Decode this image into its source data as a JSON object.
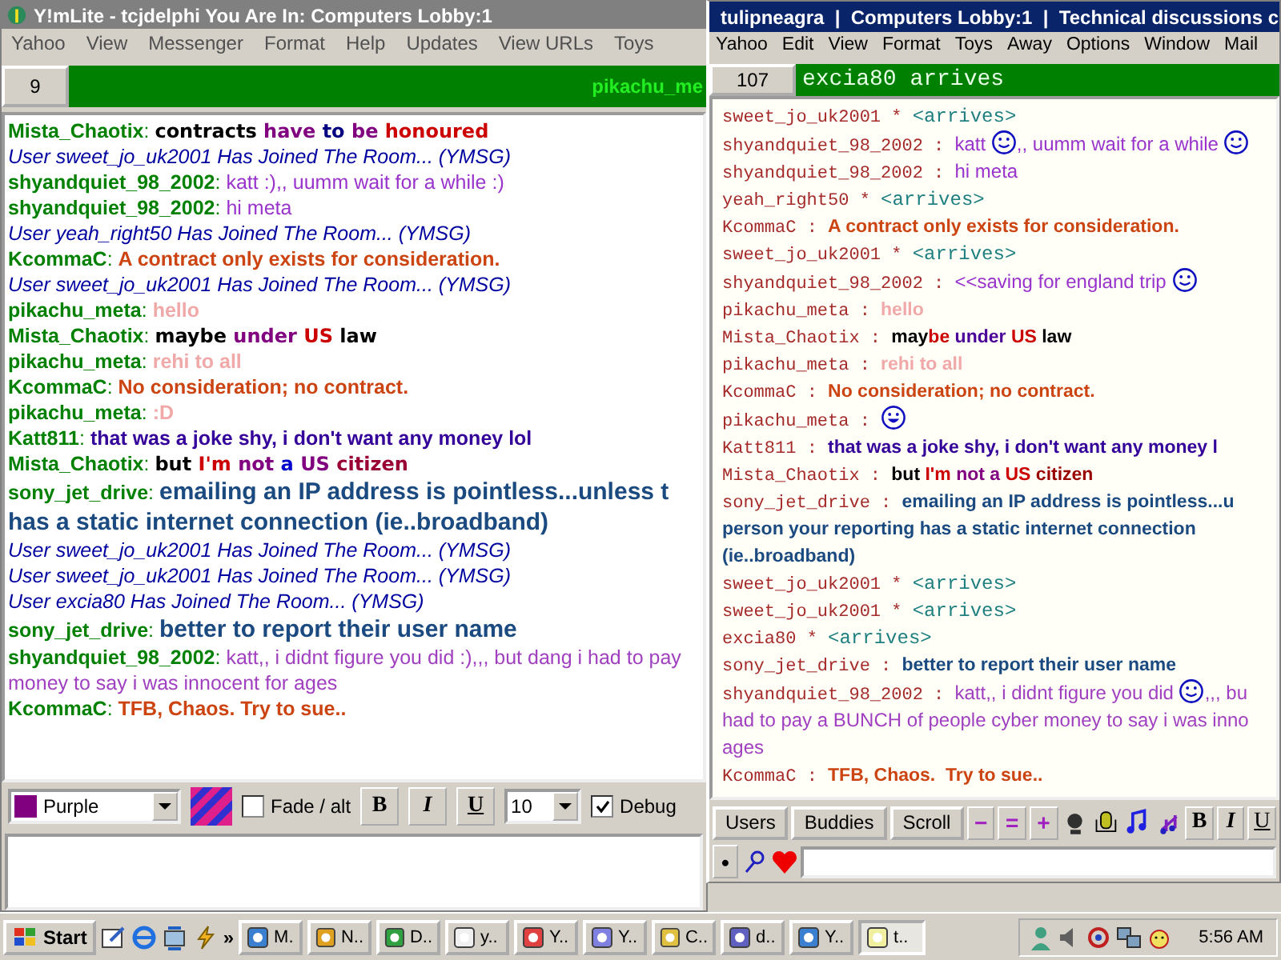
{
  "left_window": {
    "title": "Y!mLite - tcjdelphi You Are In: Computers Lobby:1",
    "menu": [
      "Yahoo",
      "View",
      "Messenger",
      "Format",
      "Help",
      "Updates",
      "View URLs",
      "Toys"
    ],
    "counter": "9",
    "ticker": "pikachu_me",
    "messages": [
      {
        "name": "Mista_Chaotix",
        "separator": ":",
        "kind": "comic",
        "segments": [
          {
            "kind": "text",
            "text": "contracts ",
            "color": "#000000"
          },
          {
            "kind": "text",
            "text": "have ",
            "color": "#800080"
          },
          {
            "kind": "text",
            "text": "to ",
            "color": "#000080"
          },
          {
            "kind": "text",
            "text": "be ",
            "color": "#800080"
          },
          {
            "kind": "text",
            "text": "honoured",
            "color": "#cc0000"
          }
        ]
      },
      {
        "kind": "join",
        "segments": [
          {
            "kind": "text",
            "text": "User sweet_jo_uk2001 Has Joined The Room... (YMSG)",
            "color": "#0000a0"
          }
        ]
      },
      {
        "name": "shyandquiet_98_2002",
        "separator": ":",
        "kind": "plain",
        "segments": [
          {
            "kind": "text",
            "text": "katt :),, uumm wait for a while :)",
            "color": "#9933cc"
          }
        ]
      },
      {
        "name": "shyandquiet_98_2002",
        "separator": ":",
        "kind": "plain",
        "segments": [
          {
            "kind": "text",
            "text": "hi meta",
            "color": "#9933cc"
          }
        ]
      },
      {
        "kind": "join",
        "segments": [
          {
            "kind": "text",
            "text": "User yeah_right50 Has Joined The Room... (YMSG)",
            "color": "#0000a0"
          }
        ]
      },
      {
        "name": "KcommaC",
        "separator": ":",
        "kind": "bold",
        "segments": [
          {
            "kind": "text",
            "text": "A contract only exists for consideration.",
            "color": "#cc4411"
          }
        ]
      },
      {
        "kind": "join",
        "segments": [
          {
            "kind": "text",
            "text": "User sweet_jo_uk2001 Has Joined The Room... (YMSG)",
            "color": "#0000a0"
          }
        ]
      },
      {
        "name": "pikachu_meta",
        "separator": ":",
        "kind": "bold",
        "segments": [
          {
            "kind": "text",
            "text": "hello",
            "color": "#f0a8a8"
          }
        ]
      },
      {
        "name": "Mista_Chaotix",
        "separator": ":",
        "kind": "comic",
        "segments": [
          {
            "kind": "text",
            "text": "maybe ",
            "color": "#000000"
          },
          {
            "kind": "text",
            "text": "under ",
            "color": "#800080"
          },
          {
            "kind": "text",
            "text": "US ",
            "color": "#cc0000"
          },
          {
            "kind": "text",
            "text": "law",
            "color": "#000000"
          }
        ]
      },
      {
        "name": "pikachu_meta",
        "separator": ":",
        "kind": "bold",
        "segments": [
          {
            "kind": "text",
            "text": "rehi to all",
            "color": "#f0a8a8"
          }
        ]
      },
      {
        "name": "KcommaC",
        "separator": ":",
        "kind": "bold",
        "segments": [
          {
            "kind": "text",
            "text": "No consideration; no contract.",
            "color": "#cc4411"
          }
        ]
      },
      {
        "name": "pikachu_meta",
        "separator": ":",
        "kind": "bold",
        "segments": [
          {
            "kind": "text",
            "text": ":D",
            "color": "#f0a8a8"
          }
        ]
      },
      {
        "name": "Katt811",
        "separator": ":",
        "kind": "bold",
        "segments": [
          {
            "kind": "text",
            "text": "that was a joke shy, i don't want any money lol",
            "color": "#330099"
          }
        ]
      },
      {
        "name": "Mista_Chaotix",
        "separator": ":",
        "kind": "comic",
        "segments": [
          {
            "kind": "text",
            "text": "but ",
            "color": "#000000"
          },
          {
            "kind": "text",
            "text": "I'm ",
            "color": "#cc0000"
          },
          {
            "kind": "text",
            "text": "not ",
            "color": "#800080"
          },
          {
            "kind": "text",
            "text": "a ",
            "color": "#0000cc"
          },
          {
            "kind": "text",
            "text": "US ",
            "color": "#800080"
          },
          {
            "kind": "text",
            "text": "citizen",
            "color": "#990033"
          }
        ]
      },
      {
        "name": "sony_jet_drive",
        "separator": ":",
        "kind": "large",
        "segments": [
          {
            "kind": "text",
            "text": "emailing an IP address is pointless...unless t",
            "color": "#1a4a80"
          }
        ],
        "continuation": [
          {
            "text": "has a static internet connection (ie..broadband)",
            "color": "#1a4a80"
          }
        ]
      },
      {
        "kind": "join",
        "segments": [
          {
            "kind": "text",
            "text": "User sweet_jo_uk2001 Has Joined The Room... (YMSG)",
            "color": "#0000a0"
          }
        ]
      },
      {
        "kind": "join",
        "segments": [
          {
            "kind": "text",
            "text": "User sweet_jo_uk2001 Has Joined The Room... (YMSG)",
            "color": "#0000a0"
          }
        ]
      },
      {
        "kind": "join",
        "segments": [
          {
            "kind": "text",
            "text": "User excia80 Has Joined The Room... (YMSG)",
            "color": "#0000a0"
          }
        ]
      },
      {
        "name": "sony_jet_drive",
        "separator": ":",
        "kind": "large",
        "segments": [
          {
            "kind": "text",
            "text": "better to report their user name",
            "color": "#1a4a80"
          }
        ]
      },
      {
        "name": "shyandquiet_98_2002",
        "separator": ":",
        "kind": "plain",
        "segments": [
          {
            "kind": "text",
            "text": "katt,, i didnt figure you did :),,, but dang i had to pay",
            "color": "#a040c0"
          }
        ],
        "continuation": [
          {
            "text": "money to say i was innocent for ages",
            "color": "#a040c0"
          }
        ]
      },
      {
        "name": "KcommaC",
        "separator": ":",
        "kind": "bold",
        "segments": [
          {
            "kind": "text",
            "text": "TFB, Chaos. Try to sue..",
            "color": "#cc4411"
          }
        ]
      }
    ],
    "toolbar": {
      "color_select": {
        "value": "Purple",
        "color": "#800080"
      },
      "fade": {
        "label": "Fade / alt",
        "checked": false
      },
      "bold": "B",
      "italic": "I",
      "underline": "U",
      "size": "10",
      "debug": {
        "label": "Debug",
        "checked": true
      }
    }
  },
  "right_window": {
    "title": "tulipneagra  |  Computers Lobby:1  |  Technical discussions c",
    "menu": [
      "Yahoo",
      "Edit",
      "View",
      "Format",
      "Toys",
      "Away",
      "Options",
      "Window",
      "Mail"
    ],
    "counter": "107",
    "ticker": "excia80 arrives",
    "messages": [
      {
        "name": "sweet_jo_uk2001",
        "separator": "*",
        "kind": "arrives",
        "segments": [
          {
            "kind": "text",
            "text": "<arrives>",
            "color": "#208080"
          }
        ]
      },
      {
        "name": "shyandquiet_98_2002",
        "separator": ":",
        "kind": "plain",
        "segments": [
          {
            "kind": "text",
            "text": "katt ",
            "color": "#9933cc"
          },
          {
            "kind": "smiley"
          },
          {
            "kind": "text",
            "text": ",, uumm wait for a while ",
            "color": "#9933cc"
          },
          {
            "kind": "smiley"
          }
        ]
      },
      {
        "name": "shyandquiet_98_2002",
        "separator": ":",
        "kind": "plain",
        "segments": [
          {
            "kind": "text",
            "text": "hi meta",
            "color": "#9933cc"
          }
        ]
      },
      {
        "name": "yeah_right50",
        "separator": "*",
        "kind": "arrives",
        "segments": [
          {
            "kind": "text",
            "text": "<arrives>",
            "color": "#208080"
          }
        ]
      },
      {
        "name": "KcommaC",
        "separator": ":",
        "kind": "bold",
        "segments": [
          {
            "kind": "text",
            "text": "A contract only exists for consideration.",
            "color": "#cc4411"
          }
        ]
      },
      {
        "name": "sweet_jo_uk2001",
        "separator": "*",
        "kind": "arrives",
        "segments": [
          {
            "kind": "text",
            "text": "<arrives>",
            "color": "#208080"
          }
        ]
      },
      {
        "name": "shyandquiet_98_2002",
        "separator": ":",
        "kind": "plain",
        "segments": [
          {
            "kind": "text",
            "text": "<<saving for england trip ",
            "color": "#9933cc"
          },
          {
            "kind": "smiley"
          }
        ]
      },
      {
        "name": "pikachu_meta",
        "separator": ":",
        "kind": "bold",
        "segments": [
          {
            "kind": "text",
            "text": "hello",
            "color": "#f0a8a8"
          }
        ]
      },
      {
        "name": "Mista_Chaotix",
        "separator": ":",
        "kind": "bold",
        "segments": [
          {
            "kind": "text",
            "text": "may",
            "color": "#000000"
          },
          {
            "kind": "text",
            "text": "be ",
            "color": "#cc0000"
          },
          {
            "kind": "text",
            "text": "under ",
            "color": "#4b0099"
          },
          {
            "kind": "text",
            "text": "US ",
            "color": "#cc0000"
          },
          {
            "kind": "text",
            "text": "law",
            "color": "#000000"
          }
        ]
      },
      {
        "name": "pikachu_meta",
        "separator": ":",
        "kind": "bold",
        "segments": [
          {
            "kind": "text",
            "text": "rehi to all",
            "color": "#f0a8a8"
          }
        ]
      },
      {
        "name": "KcommaC",
        "separator": ":",
        "kind": "bold",
        "segments": [
          {
            "kind": "text",
            "text": "No consideration; no contract.",
            "color": "#cc4411"
          }
        ]
      },
      {
        "name": "pikachu_meta",
        "separator": ":",
        "kind": "bold",
        "segments": [
          {
            "kind": "grin"
          }
        ]
      },
      {
        "name": "Katt811",
        "separator": ":",
        "kind": "bold",
        "segments": [
          {
            "kind": "text",
            "text": "that was a joke shy, i don't want any money l",
            "color": "#330099"
          }
        ]
      },
      {
        "name": "Mista_Chaotix",
        "separator": ":",
        "kind": "bold",
        "segments": [
          {
            "kind": "text",
            "text": "but ",
            "color": "#000000"
          },
          {
            "kind": "text",
            "text": "I'm ",
            "color": "#cc0000"
          },
          {
            "kind": "text",
            "text": "not a ",
            "color": "#800080"
          },
          {
            "kind": "text",
            "text": "US ",
            "color": "#cc0000"
          },
          {
            "kind": "text",
            "text": "citizen",
            "color": "#990000"
          }
        ]
      },
      {
        "name": "sony_jet_drive",
        "separator": ":",
        "kind": "bold",
        "segments": [
          {
            "kind": "text",
            "text": "emailing an IP address is pointless...u",
            "color": "#1a4a80"
          }
        ],
        "continuation": [
          {
            "text": "person your reporting has a static internet connection",
            "color": "#1a4a80"
          },
          {
            "text": "(ie..broadband)",
            "color": "#1a4a80"
          }
        ]
      },
      {
        "name": "sweet_jo_uk2001",
        "separator": "*",
        "kind": "arrives",
        "segments": [
          {
            "kind": "text",
            "text": "<arrives>",
            "color": "#208080"
          }
        ]
      },
      {
        "name": "sweet_jo_uk2001",
        "separator": "*",
        "kind": "arrives",
        "segments": [
          {
            "kind": "text",
            "text": "<arrives>",
            "color": "#208080"
          }
        ]
      },
      {
        "name": "excia80",
        "separator": "*",
        "kind": "arrives",
        "segments": [
          {
            "kind": "text",
            "text": "<arrives>",
            "color": "#208080"
          }
        ]
      },
      {
        "name": "sony_jet_drive",
        "separator": ":",
        "kind": "bold",
        "segments": [
          {
            "kind": "text",
            "text": "better to report their user name",
            "color": "#1a4a80"
          }
        ]
      },
      {
        "name": "shyandquiet_98_2002",
        "separator": ":",
        "kind": "plain",
        "segments": [
          {
            "kind": "text",
            "text": "katt,, i didnt figure you did ",
            "color": "#a040c0"
          },
          {
            "kind": "smiley"
          },
          {
            "kind": "text",
            "text": ",,, bu",
            "color": "#a040c0"
          }
        ],
        "continuation": [
          {
            "text": "had to pay a BUNCH of people cyber money to say i was inno",
            "color": "#a040c0"
          },
          {
            "text": "ages",
            "color": "#a040c0"
          }
        ]
      },
      {
        "name": "KcommaC",
        "separator": ":",
        "kind": "bold",
        "segments": [
          {
            "kind": "text",
            "text": "TFB, Chaos.  Try to sue..",
            "color": "#cc4411"
          }
        ]
      }
    ],
    "tabs": [
      "Users",
      "Buddies",
      "Scroll"
    ],
    "size_buttons": [
      "−",
      "=",
      "+"
    ],
    "style_buttons": [
      "B",
      "I",
      "U"
    ],
    "dot": "•"
  },
  "taskbar": {
    "start": "Start",
    "more": "»",
    "tasks": [
      {
        "label": "M.",
        "selected": false
      },
      {
        "label": "N..",
        "selected": false
      },
      {
        "label": "D..",
        "selected": false
      },
      {
        "label": "y..",
        "selected": false
      },
      {
        "label": "Y..",
        "selected": false
      },
      {
        "label": "Y..",
        "selected": false
      },
      {
        "label": "C..",
        "selected": false
      },
      {
        "label": "d..",
        "selected": false
      },
      {
        "label": "Y..",
        "selected": false
      },
      {
        "label": "t..",
        "selected": true
      }
    ],
    "clock": "5:56 AM"
  }
}
